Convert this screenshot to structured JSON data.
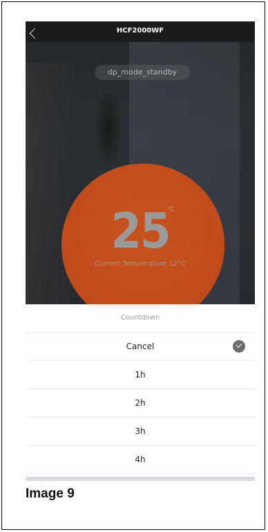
{
  "app": {
    "title": "HCF2000WF"
  },
  "mode": {
    "label": "dp_mode_standby"
  },
  "thermostat": {
    "set_temperature": "25",
    "unit": "°C",
    "current_label": "Current Temperature 12°C"
  },
  "countdown": {
    "title": "Countdown",
    "options": [
      {
        "label": "Cancel",
        "selected": true
      },
      {
        "label": "1h",
        "selected": false
      },
      {
        "label": "2h",
        "selected": false
      },
      {
        "label": "3h",
        "selected": false
      },
      {
        "label": "4h",
        "selected": false
      }
    ]
  },
  "caption": "Image 9",
  "colors": {
    "dial": "#c24c1c",
    "topbar": "#1a1c1e",
    "check": "#6b6b6b"
  },
  "icons": {
    "back": "chevron-left-icon",
    "selected": "check-circle-icon"
  }
}
